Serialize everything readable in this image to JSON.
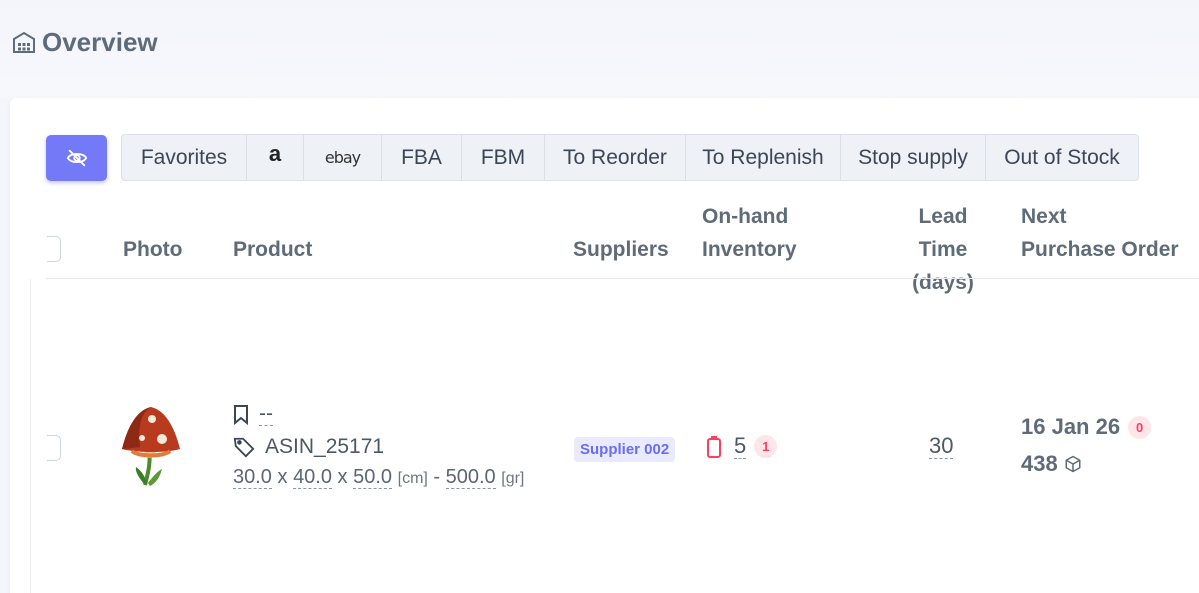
{
  "page": {
    "title": "Overview"
  },
  "filters": [
    {
      "label": "Favorites",
      "w": 125
    },
    {
      "label": "a",
      "kind": "amazon",
      "icon": "amazon-logo-icon"
    },
    {
      "label": "ebay",
      "kind": "ebay",
      "icon": "ebay-logo-icon"
    },
    {
      "label": "FBA"
    },
    {
      "label": "FBM"
    },
    {
      "label": "To Reorder"
    },
    {
      "label": "To Replenish"
    },
    {
      "label": "Stop supply"
    },
    {
      "label": "Out of Stock"
    }
  ],
  "table": {
    "headers": {
      "photo": "Photo",
      "product": "Product",
      "suppliers": "Suppliers",
      "inventory_1": "On-hand",
      "inventory_2": "Inventory",
      "lead_1": "Lead",
      "lead_2": "Time (days)",
      "npo_1": "Next",
      "npo_2": "Purchase Order"
    },
    "rows": [
      {
        "bookmark": "--",
        "sku": "ASIN_25171",
        "length": "30.0",
        "width": "40.0",
        "height": "50.0",
        "dim_unit": "[cm]",
        "weight": "500.0",
        "weight_unit": "[gr]",
        "supplier": "Supplier 002",
        "on_hand": "5",
        "on_hand_badge": "1",
        "lead_time": "30",
        "npo_date": "16 Jan 26",
        "npo_badge": "0",
        "npo_qty": "438"
      }
    ]
  },
  "colors": {
    "accent": "#7479f7",
    "danger": "#ff3e5d"
  }
}
